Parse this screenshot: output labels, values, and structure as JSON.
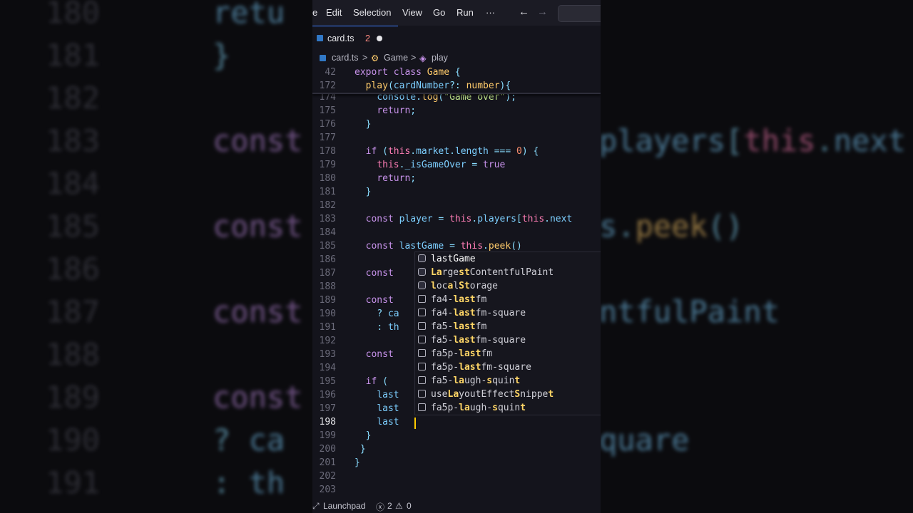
{
  "background": {
    "lines": [
      {
        "num": "180",
        "code": "retu"
      },
      {
        "num": "181",
        "code": "}"
      },
      {
        "num": "182",
        "code": ""
      },
      {
        "num": "183",
        "code": "const",
        "right": "players[this.next"
      },
      {
        "num": "184",
        "code": ""
      },
      {
        "num": "185",
        "code": "const",
        "right": "s.peek()"
      },
      {
        "num": "186",
        "code": ""
      },
      {
        "num": "187",
        "code": "const",
        "right": "ntfulPaint"
      },
      {
        "num": "188",
        "code": ""
      },
      {
        "num": "189",
        "code": "const",
        "right": ""
      },
      {
        "num": "190",
        "code": "? ca",
        "right": "quare"
      },
      {
        "num": "191",
        "code": ": th",
        "right": ""
      }
    ]
  },
  "menubar": {
    "edge_label": "e",
    "items": [
      "Edit",
      "Selection",
      "View",
      "Go",
      "Run"
    ],
    "more_label": "···",
    "back_arrow": "←",
    "forward_arrow": "→"
  },
  "tab": {
    "filename": "card.ts",
    "problems": "2"
  },
  "breadcrumbs": {
    "file": "card.ts",
    "class": "Game",
    "method": "play",
    "sep": ">"
  },
  "code": {
    "sticky": [
      {
        "ln": "42",
        "text": "export class Game {"
      },
      {
        "ln": "172",
        "text": "  play(cardNumber?: number){"
      }
    ],
    "lines": [
      {
        "ln": "174",
        "text": "    console.log(\"Game over\");"
      },
      {
        "ln": "175",
        "text": "    return;"
      },
      {
        "ln": "176",
        "text": "  }"
      },
      {
        "ln": "177",
        "text": ""
      },
      {
        "ln": "178",
        "text": "  if (this.market.length === 0) {"
      },
      {
        "ln": "179",
        "text": "    this._isGameOver = true"
      },
      {
        "ln": "180",
        "text": "    return;"
      },
      {
        "ln": "181",
        "text": "  }"
      },
      {
        "ln": "182",
        "text": ""
      },
      {
        "ln": "183",
        "text": "  const player = this.players[this.next"
      },
      {
        "ln": "184",
        "text": ""
      },
      {
        "ln": "185",
        "text": "  const lastGame = this.peek()"
      },
      {
        "ln": "186",
        "text": ""
      },
      {
        "ln": "187",
        "text": "  const"
      },
      {
        "ln": "188",
        "text": ""
      },
      {
        "ln": "189",
        "text": "  const"
      },
      {
        "ln": "190",
        "text": "    ? ca"
      },
      {
        "ln": "191",
        "text": "    : th"
      },
      {
        "ln": "192",
        "text": ""
      },
      {
        "ln": "193",
        "text": "  const"
      },
      {
        "ln": "194",
        "text": ""
      },
      {
        "ln": "195",
        "text": "  if ("
      },
      {
        "ln": "196",
        "text": "    last"
      },
      {
        "ln": "197",
        "text": "    last"
      },
      {
        "ln": "198",
        "text": "    last"
      },
      {
        "ln": "199",
        "text": "  }"
      },
      {
        "ln": "200",
        "text": " }"
      },
      {
        "ln": "201",
        "text": "}"
      },
      {
        "ln": "202",
        "text": ""
      },
      {
        "ln": "203",
        "text": ""
      }
    ]
  },
  "suggestions": [
    {
      "kind": "variable",
      "label": "lastGame"
    },
    {
      "kind": "variable",
      "label": "LargestContentfulPaint"
    },
    {
      "kind": "variable",
      "label": "localStorage"
    },
    {
      "kind": "snippet",
      "label": "fa4-lastfm"
    },
    {
      "kind": "snippet",
      "label": "fa4-lastfm-square"
    },
    {
      "kind": "snippet",
      "label": "fa5-lastfm"
    },
    {
      "kind": "snippet",
      "label": "fa5-lastfm-square"
    },
    {
      "kind": "snippet",
      "label": "fa5p-lastfm"
    },
    {
      "kind": "snippet",
      "label": "fa5p-lastfm-square"
    },
    {
      "kind": "snippet",
      "label": "fa5-laugh-squint"
    },
    {
      "kind": "snippet",
      "label": "useLayoutEffectSnippet"
    },
    {
      "kind": "snippet",
      "label": "fa5p-laugh-squint"
    }
  ],
  "statusbar": {
    "remote": "Launchpad",
    "errors": "2",
    "warnings": "0"
  },
  "colors": {
    "accent": "#3d7eff",
    "cursor": "#ffcc00",
    "highlight": "#ffd666"
  }
}
